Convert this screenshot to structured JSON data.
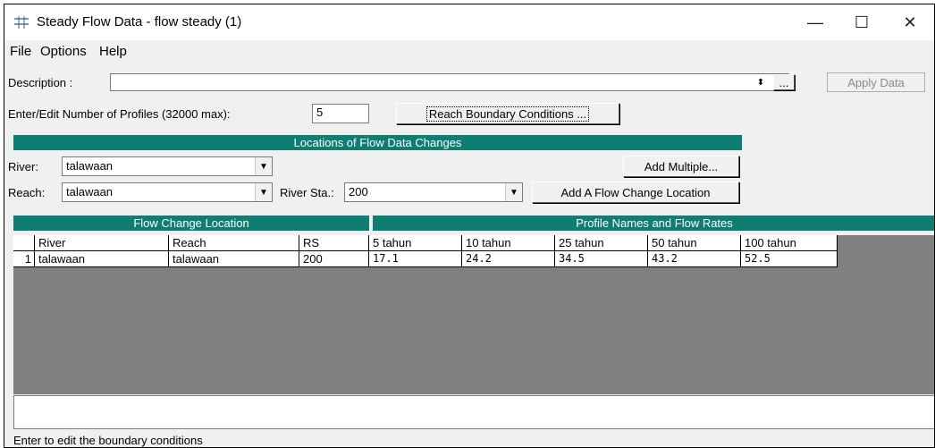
{
  "window": {
    "title": "Steady Flow Data - flow steady (1)",
    "minimize": "—",
    "maximize": "☐",
    "close": "✕"
  },
  "menu": [
    "File",
    "Options",
    "Help"
  ],
  "description": {
    "label": "Description :",
    "value": "",
    "ellipsis": "...",
    "apply": "Apply Data"
  },
  "profiles": {
    "label": "Enter/Edit Number of Profiles (32000 max):",
    "value": "5",
    "reach_bc_button": "Reach Boundary Conditions ..."
  },
  "locations": {
    "header": "Locations of Flow Data Changes",
    "river_label": "River:",
    "river_value": "talawaan",
    "reach_label": "Reach:",
    "reach_value": "talawaan",
    "station_label": "River Sta.:",
    "station_value": "200",
    "add_multiple": "Add Multiple...",
    "add_location": "Add A Flow Change Location"
  },
  "table": {
    "left_header": "Flow Change Location",
    "right_header": "Profile Names and Flow Rates",
    "columns": [
      "River",
      "Reach",
      "RS",
      "5 tahun",
      "10 tahun",
      "25 tahun",
      "50 tahun",
      "100 tahun"
    ],
    "rows": [
      {
        "num": "1",
        "cells": [
          "talawaan",
          "talawaan",
          "200",
          "17.1",
          "24.2",
          "34.5",
          "43.2",
          "52.5"
        ]
      }
    ]
  },
  "status": "Enter to edit the boundary conditions"
}
